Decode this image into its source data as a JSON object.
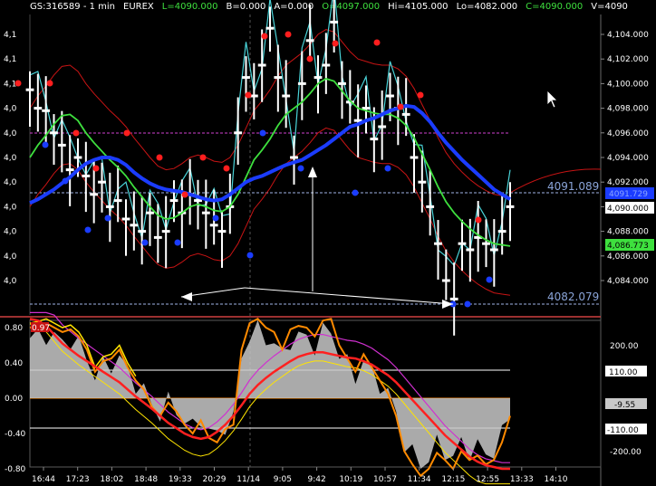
{
  "header": {
    "symbol": "GS:316589 - 1 min",
    "exchange": "EUREX",
    "last": "L=4090.000",
    "bid": "B=0.000",
    "ask": "A=0.000",
    "open": "O=4097.000",
    "high": "Hi=4105.000",
    "low": "Lo=4082.000",
    "close": "C=4090.000",
    "volume": "V=4090"
  },
  "colors": {
    "background": "#000000",
    "price_up": "#ffffff",
    "price_alt": "#49d3d8",
    "ma_slow": "#1b3cff",
    "ma_mid": "#3ee03e",
    "envelope": "#c81414",
    "level_line": "#9fb4e6",
    "resistance_line": "#d040d0",
    "dot_high": "#ff1e1e",
    "dot_low": "#1a3cff",
    "osc_main": "#ff8a00",
    "osc_fast": "#ffe400",
    "osc_slow": "#ff2020",
    "osc_band": "#d030d0",
    "histogram": "#c8c8c8"
  },
  "levels": {
    "upper": "4091.089",
    "lower": "4082.079"
  },
  "price_tags": {
    "ma_slow_tag": "4091.729",
    "last_tag": "4,090.000",
    "ma_mid_tag": "4,086.773"
  },
  "osc_tags": {
    "top_left": "0.97",
    "upper": "110.00",
    "mid": "-9.55",
    "lower": "-110.00"
  },
  "price_axis": [
    "4,104.000",
    "4,102.000",
    "4,100.000",
    "4,098.000",
    "4,096.000",
    "4,094.000",
    "4,092.000",
    "4,090.000",
    "4,088.000",
    "4,086.000",
    "4,084.000"
  ],
  "price_axis_values": [
    4104,
    4102,
    4100,
    4098,
    4096,
    4094,
    4092,
    4090,
    4088,
    4086,
    4084
  ],
  "left_price_axis": [
    "4,1",
    "4,1",
    "4,1",
    "4,0",
    "4,0",
    "4,0",
    "4,0",
    "4,0",
    "4,0",
    "4,0",
    "4,0"
  ],
  "osc_left_axis": [
    "0.80",
    "0.40",
    "0.00",
    "-0.40",
    "-0.80"
  ],
  "osc_left_values": [
    0.8,
    0.4,
    0,
    -0.4,
    -0.8
  ],
  "osc_right_axis": [
    "200.00",
    "-200.00"
  ],
  "osc_right_values": [
    200,
    -200
  ],
  "time_axis": [
    "16:44",
    "17:23",
    "18:02",
    "18:48",
    "19:33",
    "20:29",
    "11/14",
    "9:05",
    "9:42",
    "10:19",
    "10:57",
    "11:34",
    "12:15",
    "12:55",
    "13:33",
    "14:10"
  ],
  "icons": {
    "cursor": "mouse-pointer-icon"
  },
  "chart_data": [
    {
      "type": "line",
      "title": "",
      "ylim": [
        4082,
        4106
      ],
      "series": [
        {
          "values": [
            4099.5,
            4098,
            4097.8,
            4096,
            4095,
            4093,
            4094,
            4092.5,
            4091,
            4092,
            4090,
            4090.5,
            4089,
            4088.5,
            4088,
            4089.5,
            4087.5,
            4088,
            4090.5,
            4089.5,
            4091,
            4090.5,
            4089.5,
            4088.5,
            4088,
            4090,
            4096,
            4100.5,
            4099,
            4101.5,
            4104.5,
            4100.5,
            4099,
            4094,
            4100,
            4103.5,
            4100.5,
            4101.5,
            4105,
            4100,
            4098.5,
            4097,
            4098,
            4095.5,
            4096.5,
            4099,
            4098,
            4097.5,
            4094,
            4092,
            4090,
            4087,
            4084,
            4082.5,
            4087,
            4086.5,
            4087.5,
            4087,
            4086.5,
            4088,
            4090
          ]
        },
        {
          "values": [
            4090.3,
            4090.6,
            4091,
            4091.4,
            4091.9,
            4092.4,
            4093,
            4093.5,
            4093.8,
            4094,
            4094,
            4093.8,
            4093.4,
            4092.8,
            4092.3,
            4091.9,
            4091.6,
            4091.4,
            4091.3,
            4091.2,
            4091,
            4090.8,
            4090.6,
            4090.5,
            4090.6,
            4091,
            4091.5,
            4092,
            4092.3,
            4092.5,
            4092.8,
            4093.1,
            4093.4,
            4093.6,
            4093.8,
            4094.2,
            4094.6,
            4095,
            4095.5,
            4096,
            4096.5,
            4096.7,
            4097,
            4097.2,
            4097.5,
            4097.8,
            4098,
            4098.2,
            4098.1,
            4097.6,
            4096.9,
            4096,
            4095.2,
            4094.5,
            4093.8,
            4093.2,
            4092.6,
            4092,
            4091.4,
            4091,
            4090.6
          ]
        },
        {
          "values": [
            4094,
            4095,
            4095.8,
            4096.7,
            4097.4,
            4097.5,
            4097,
            4096,
            4095.2,
            4094.5,
            4093.8,
            4093.2,
            4092.5,
            4091.6,
            4090.8,
            4090,
            4089.3,
            4089,
            4089.1,
            4089.5,
            4090,
            4090.2,
            4090,
            4089.7,
            4089.6,
            4090,
            4091,
            4092.4,
            4093.8,
            4094.6,
            4095.5,
            4096.6,
            4097.5,
            4098,
            4098.5,
            4099.2,
            4100,
            4100.4,
            4100.2,
            4099.4,
            4098.6,
            4098,
            4097.8,
            4097.6,
            4097.5,
            4097.5,
            4097.2,
            4096.6,
            4095.6,
            4094.3,
            4093,
            4091.6,
            4090.4,
            4089.5,
            4088.8,
            4088.2,
            4087.7,
            4087.3,
            4087,
            4086.9,
            4086.8
          ]
        }
      ]
    },
    {
      "type": "line",
      "title": "",
      "ylim": [
        -0.97,
        0.97
      ],
      "series": [
        {
          "values": [
            0.8,
            0.82,
            0.85,
            0.8,
            0.75,
            0.78,
            0.7,
            0.55,
            0.3,
            0.42,
            0.45,
            0.55,
            0.35,
            0.2,
            0.1,
            -0.1,
            -0.2,
            -0.05,
            -0.15,
            -0.3,
            -0.4,
            -0.25,
            -0.45,
            -0.5,
            -0.35,
            -0.3,
            0.55,
            0.85,
            0.9,
            0.8,
            0.75,
            0.55,
            0.78,
            0.82,
            0.8,
            0.7,
            0.88,
            0.9,
            0.6,
            0.45,
            0.3,
            0.5,
            0.35,
            0.2,
            0.05,
            -0.2,
            -0.6,
            -0.75,
            -0.88,
            -0.8,
            -0.62,
            -0.7,
            -0.8,
            -0.6,
            -0.7,
            -0.65,
            -0.75,
            -0.7,
            -0.5,
            -0.2
          ]
        },
        {
          "values": [
            0.9,
            0.88,
            0.82,
            0.72,
            0.62,
            0.55,
            0.48,
            0.42,
            0.36,
            0.3,
            0.24,
            0.18,
            0.1,
            0.02,
            -0.05,
            -0.12,
            -0.2,
            -0.28,
            -0.34,
            -0.4,
            -0.44,
            -0.46,
            -0.44,
            -0.38,
            -0.3,
            -0.2,
            -0.08,
            0.05,
            0.15,
            0.23,
            0.3,
            0.36,
            0.42,
            0.47,
            0.5,
            0.52,
            0.52,
            0.5,
            0.48,
            0.46,
            0.45,
            0.42,
            0.38,
            0.32,
            0.26,
            0.18,
            0.08,
            -0.02,
            -0.12,
            -0.22,
            -0.32,
            -0.42,
            -0.5,
            -0.58,
            -0.66,
            -0.72,
            -0.76,
            -0.78,
            -0.8,
            -0.8
          ]
        }
      ]
    }
  ]
}
